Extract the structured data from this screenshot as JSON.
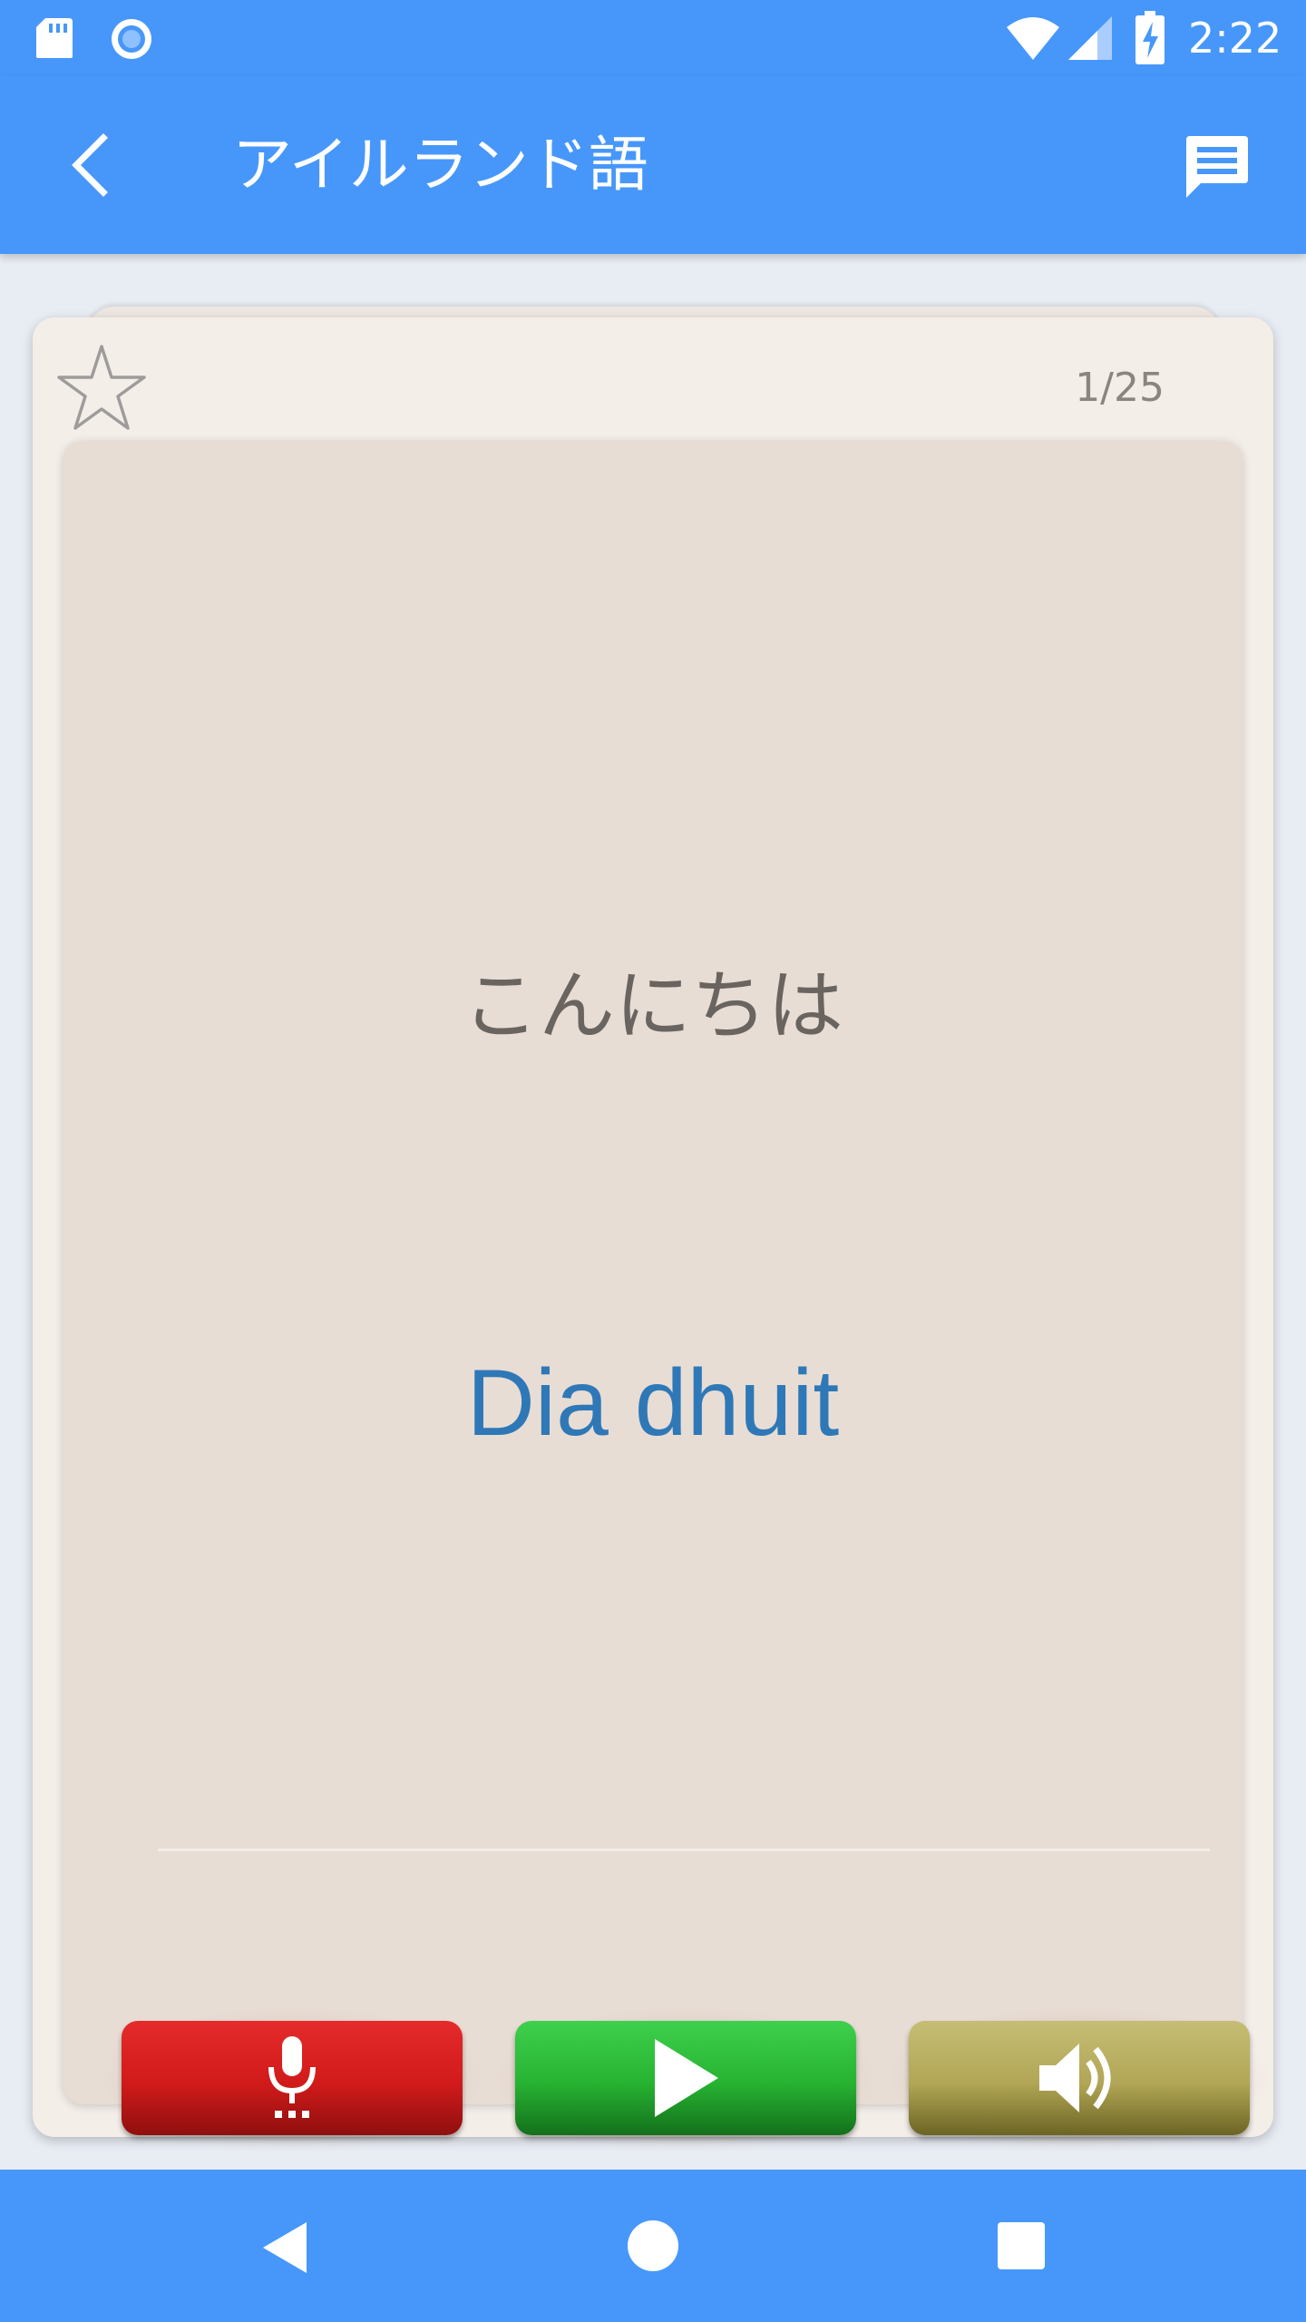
{
  "status_bar": {
    "time": "2:22",
    "icons": [
      "sd-card-icon",
      "sync-icon",
      "wifi-icon",
      "cell-signal-icon",
      "battery-charging-icon"
    ]
  },
  "app_bar": {
    "title": "アイルランド語",
    "back_icon": "chevron-left-icon",
    "action_icon": "message-icon"
  },
  "card": {
    "counter": "1/25",
    "favorite_icon": "star-outline-icon",
    "source_text": "こんにちは",
    "target_text": "Dia dhuit"
  },
  "buttons": {
    "record": {
      "icon": "microphone-icon",
      "color": "#d11a1a"
    },
    "play": {
      "icon": "play-icon",
      "color": "#27b232"
    },
    "listen": {
      "icon": "speaker-icon",
      "color": "#b1a655"
    }
  },
  "nav_bar": {
    "icons": [
      "triangle-back-icon",
      "circle-home-icon",
      "square-recents-icon"
    ]
  },
  "colors": {
    "primary": "#4797fb",
    "background": "#e8ecf3",
    "card_outer": "#f4eee9",
    "card_inner": "#e8ddd5",
    "source_text": "#6a6460",
    "target_text": "#2f78b7"
  }
}
